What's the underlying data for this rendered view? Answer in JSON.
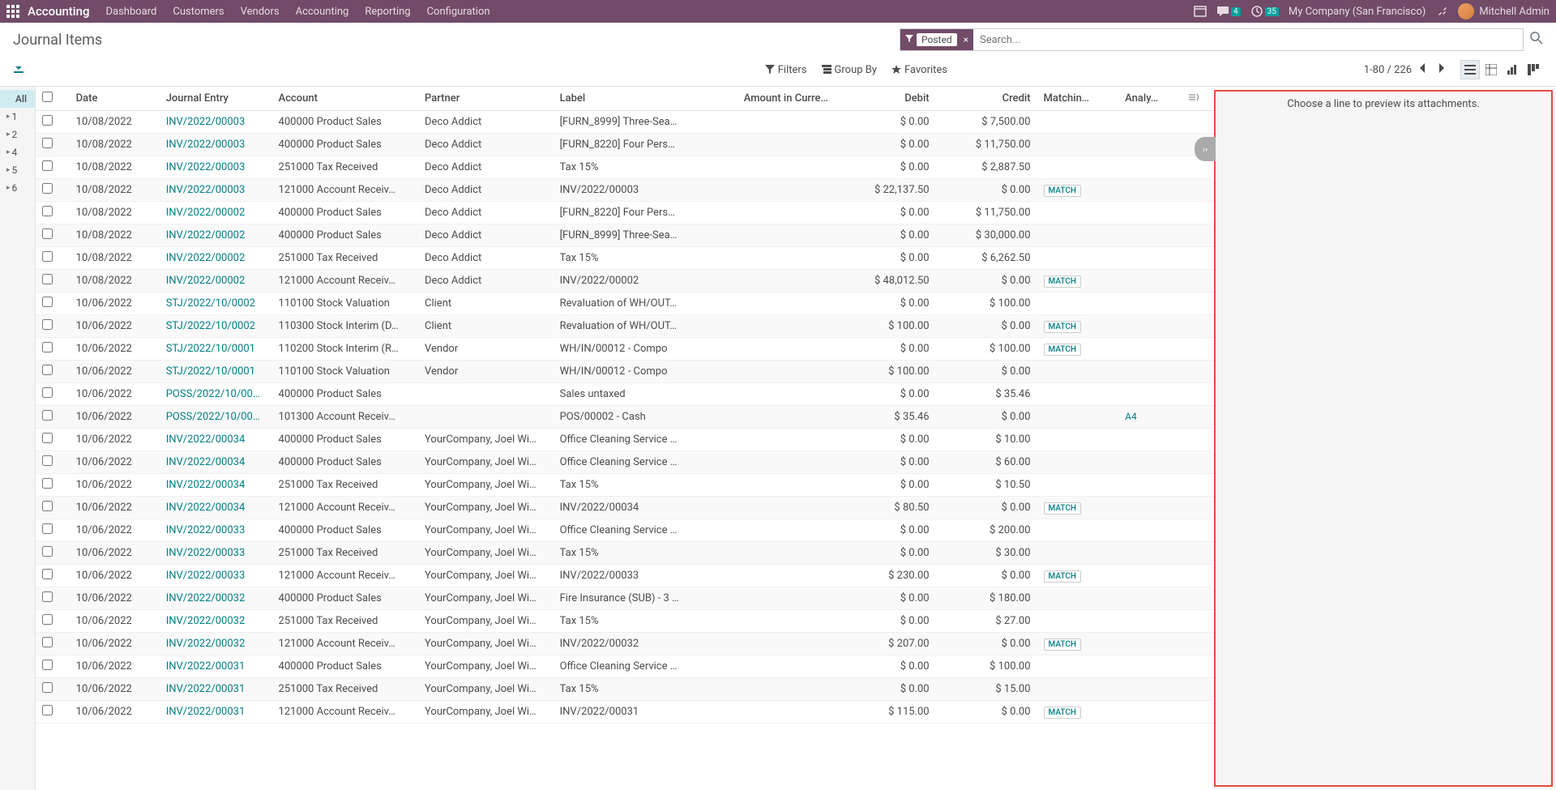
{
  "nav": {
    "app": "Accounting",
    "items": [
      "Dashboard",
      "Customers",
      "Vendors",
      "Accounting",
      "Reporting",
      "Configuration"
    ],
    "msg_badge": "4",
    "clock_badge": "35",
    "company": "My Company (San Francisco)",
    "user": "Mitchell Admin"
  },
  "breadcrumb": "Journal Items",
  "search": {
    "facet": "Posted",
    "placeholder": "Search..."
  },
  "options": {
    "filters": "Filters",
    "groupby": "Group By",
    "favorites": "Favorites"
  },
  "pager": {
    "range": "1-80",
    "total": "226"
  },
  "sidebar": [
    "All",
    "1",
    "2",
    "4",
    "5",
    "6"
  ],
  "headers": {
    "date": "Date",
    "je": "Journal Entry",
    "acc": "Account",
    "partner": "Partner",
    "label": "Label",
    "amt": "Amount in Curre…",
    "debit": "Debit",
    "credit": "Credit",
    "match": "Matchin…",
    "analy": "Analy…"
  },
  "preview": "Choose a line to preview its attachments.",
  "rows": [
    {
      "date": "10/08/2022",
      "je": "INV/2022/00003",
      "acc": "400000 Product Sales",
      "partner": "Deco Addict",
      "label": "[FURN_8999] Three-Sea…",
      "amt": "",
      "debit": "$ 0.00",
      "credit": "$ 7,500.00",
      "match": "",
      "analy": ""
    },
    {
      "date": "10/08/2022",
      "je": "INV/2022/00003",
      "acc": "400000 Product Sales",
      "partner": "Deco Addict",
      "label": "[FURN_8220] Four Pers…",
      "amt": "",
      "debit": "$ 0.00",
      "credit": "$ 11,750.00",
      "match": "",
      "analy": ""
    },
    {
      "date": "10/08/2022",
      "je": "INV/2022/00003",
      "acc": "251000 Tax Received",
      "partner": "Deco Addict",
      "label": "Tax 15%",
      "amt": "",
      "debit": "$ 0.00",
      "credit": "$ 2,887.50",
      "match": "",
      "analy": ""
    },
    {
      "date": "10/08/2022",
      "je": "INV/2022/00003",
      "acc": "121000 Account Receiv…",
      "partner": "Deco Addict",
      "label": "INV/2022/00003",
      "amt": "",
      "debit": "$ 22,137.50",
      "credit": "$ 0.00",
      "match": "MATCH",
      "analy": ""
    },
    {
      "date": "10/08/2022",
      "je": "INV/2022/00002",
      "acc": "400000 Product Sales",
      "partner": "Deco Addict",
      "label": "[FURN_8220] Four Pers…",
      "amt": "",
      "debit": "$ 0.00",
      "credit": "$ 11,750.00",
      "match": "",
      "analy": ""
    },
    {
      "date": "10/08/2022",
      "je": "INV/2022/00002",
      "acc": "400000 Product Sales",
      "partner": "Deco Addict",
      "label": "[FURN_8999] Three-Sea…",
      "amt": "",
      "debit": "$ 0.00",
      "credit": "$ 30,000.00",
      "match": "",
      "analy": ""
    },
    {
      "date": "10/08/2022",
      "je": "INV/2022/00002",
      "acc": "251000 Tax Received",
      "partner": "Deco Addict",
      "label": "Tax 15%",
      "amt": "",
      "debit": "$ 0.00",
      "credit": "$ 6,262.50",
      "match": "",
      "analy": ""
    },
    {
      "date": "10/08/2022",
      "je": "INV/2022/00002",
      "acc": "121000 Account Receiv…",
      "partner": "Deco Addict",
      "label": "INV/2022/00002",
      "amt": "",
      "debit": "$ 48,012.50",
      "credit": "$ 0.00",
      "match": "MATCH",
      "analy": ""
    },
    {
      "date": "10/06/2022",
      "je": "STJ/2022/10/0002",
      "acc": "110100 Stock Valuation",
      "partner": "Client",
      "label": "Revaluation of WH/OUT…",
      "amt": "",
      "debit": "$ 0.00",
      "credit": "$ 100.00",
      "match": "",
      "analy": ""
    },
    {
      "date": "10/06/2022",
      "je": "STJ/2022/10/0002",
      "acc": "110300 Stock Interim (D…",
      "partner": "Client",
      "label": "Revaluation of WH/OUT…",
      "amt": "",
      "debit": "$ 100.00",
      "credit": "$ 0.00",
      "match": "MATCH",
      "analy": ""
    },
    {
      "date": "10/06/2022",
      "je": "STJ/2022/10/0001",
      "acc": "110200 Stock Interim (R…",
      "partner": "Vendor",
      "label": "WH/IN/00012 - Compo",
      "amt": "",
      "debit": "$ 0.00",
      "credit": "$ 100.00",
      "match": "MATCH",
      "analy": ""
    },
    {
      "date": "10/06/2022",
      "je": "STJ/2022/10/0001",
      "acc": "110100 Stock Valuation",
      "partner": "Vendor",
      "label": "WH/IN/00012 - Compo",
      "amt": "",
      "debit": "$ 100.00",
      "credit": "$ 0.00",
      "match": "",
      "analy": ""
    },
    {
      "date": "10/06/2022",
      "je": "POSS/2022/10/00…",
      "acc": "400000 Product Sales",
      "partner": "",
      "label": "Sales untaxed",
      "amt": "",
      "debit": "$ 0.00",
      "credit": "$ 35.46",
      "match": "",
      "analy": ""
    },
    {
      "date": "10/06/2022",
      "je": "POSS/2022/10/00…",
      "acc": "101300 Account Receiv…",
      "partner": "",
      "label": "POS/00002 - Cash",
      "amt": "",
      "debit": "$ 35.46",
      "credit": "$ 0.00",
      "match": "",
      "analy": "A4"
    },
    {
      "date": "10/06/2022",
      "je": "INV/2022/00034",
      "acc": "400000 Product Sales",
      "partner": "YourCompany, Joel Wi…",
      "label": "Office Cleaning Service …",
      "amt": "",
      "debit": "$ 0.00",
      "credit": "$ 10.00",
      "match": "",
      "analy": ""
    },
    {
      "date": "10/06/2022",
      "je": "INV/2022/00034",
      "acc": "400000 Product Sales",
      "partner": "YourCompany, Joel Wi…",
      "label": "Office Cleaning Service …",
      "amt": "",
      "debit": "$ 0.00",
      "credit": "$ 60.00",
      "match": "",
      "analy": ""
    },
    {
      "date": "10/06/2022",
      "je": "INV/2022/00034",
      "acc": "251000 Tax Received",
      "partner": "YourCompany, Joel Wi…",
      "label": "Tax 15%",
      "amt": "",
      "debit": "$ 0.00",
      "credit": "$ 10.50",
      "match": "",
      "analy": ""
    },
    {
      "date": "10/06/2022",
      "je": "INV/2022/00034",
      "acc": "121000 Account Receiv…",
      "partner": "YourCompany, Joel Wi…",
      "label": "INV/2022/00034",
      "amt": "",
      "debit": "$ 80.50",
      "credit": "$ 0.00",
      "match": "MATCH",
      "analy": ""
    },
    {
      "date": "10/06/2022",
      "je": "INV/2022/00033",
      "acc": "400000 Product Sales",
      "partner": "YourCompany, Joel Wi…",
      "label": "Office Cleaning Service …",
      "amt": "",
      "debit": "$ 0.00",
      "credit": "$ 200.00",
      "match": "",
      "analy": ""
    },
    {
      "date": "10/06/2022",
      "je": "INV/2022/00033",
      "acc": "251000 Tax Received",
      "partner": "YourCompany, Joel Wi…",
      "label": "Tax 15%",
      "amt": "",
      "debit": "$ 0.00",
      "credit": "$ 30.00",
      "match": "",
      "analy": ""
    },
    {
      "date": "10/06/2022",
      "je": "INV/2022/00033",
      "acc": "121000 Account Receiv…",
      "partner": "YourCompany, Joel Wi…",
      "label": "INV/2022/00033",
      "amt": "",
      "debit": "$ 230.00",
      "credit": "$ 0.00",
      "match": "MATCH",
      "analy": ""
    },
    {
      "date": "10/06/2022",
      "je": "INV/2022/00032",
      "acc": "400000 Product Sales",
      "partner": "YourCompany, Joel Wi…",
      "label": "Fire Insurance (SUB) - 3 …",
      "amt": "",
      "debit": "$ 0.00",
      "credit": "$ 180.00",
      "match": "",
      "analy": ""
    },
    {
      "date": "10/06/2022",
      "je": "INV/2022/00032",
      "acc": "251000 Tax Received",
      "partner": "YourCompany, Joel Wi…",
      "label": "Tax 15%",
      "amt": "",
      "debit": "$ 0.00",
      "credit": "$ 27.00",
      "match": "",
      "analy": ""
    },
    {
      "date": "10/06/2022",
      "je": "INV/2022/00032",
      "acc": "121000 Account Receiv…",
      "partner": "YourCompany, Joel Wi…",
      "label": "INV/2022/00032",
      "amt": "",
      "debit": "$ 207.00",
      "credit": "$ 0.00",
      "match": "MATCH",
      "analy": ""
    },
    {
      "date": "10/06/2022",
      "je": "INV/2022/00031",
      "acc": "400000 Product Sales",
      "partner": "YourCompany, Joel Wi…",
      "label": "Office Cleaning Service …",
      "amt": "",
      "debit": "$ 0.00",
      "credit": "$ 100.00",
      "match": "",
      "analy": ""
    },
    {
      "date": "10/06/2022",
      "je": "INV/2022/00031",
      "acc": "251000 Tax Received",
      "partner": "YourCompany, Joel Wi…",
      "label": "Tax 15%",
      "amt": "",
      "debit": "$ 0.00",
      "credit": "$ 15.00",
      "match": "",
      "analy": ""
    },
    {
      "date": "10/06/2022",
      "je": "INV/2022/00031",
      "acc": "121000 Account Receiv…",
      "partner": "YourCompany, Joel Wi…",
      "label": "INV/2022/00031",
      "amt": "",
      "debit": "$ 115.00",
      "credit": "$ 0.00",
      "match": "MATCH",
      "analy": ""
    }
  ]
}
